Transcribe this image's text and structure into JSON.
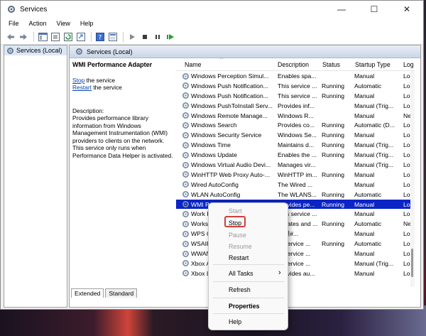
{
  "window": {
    "title": "Services",
    "controls": {
      "minimize": "—",
      "maximize": "☐",
      "close": "✕"
    }
  },
  "menu": [
    "File",
    "Action",
    "View",
    "Help"
  ],
  "toolbar_icons": [
    "back-icon",
    "forward-icon",
    "console-tree-icon",
    "properties-icon",
    "refresh-icon",
    "export-icon",
    "help-icon",
    "view-icon",
    "start-icon",
    "stop-icon",
    "pause-icon",
    "restart-icon"
  ],
  "tree": {
    "item": "Services (Local)"
  },
  "main": {
    "header": "Services (Local)"
  },
  "detail": {
    "title": "WMI Performance Adapter",
    "stop_link": "Stop",
    "stop_rest": " the service",
    "restart_link": "Restart",
    "restart_rest": " the service",
    "desc_label": "Description:",
    "desc_lines": [
      "Provides performance library",
      "information from Windows",
      "Management Instrumentation (WMI)",
      "providers to clients on the network.",
      "This service only runs when",
      "Performance Data Helper is activated."
    ]
  },
  "columns": [
    "Name",
    "Description",
    "Status",
    "Startup Type",
    "Log"
  ],
  "rows": [
    [
      "Windows Perception Simul...",
      "Enables spa...",
      "",
      "Manual",
      "Loc"
    ],
    [
      "Windows Push Notification...",
      "This service ...",
      "Running",
      "Automatic",
      "Loc"
    ],
    [
      "Windows Push Notification...",
      "This service ...",
      "Running",
      "Manual",
      "Loc"
    ],
    [
      "Windows PushToInstall Serv...",
      "Provides inf...",
      "",
      "Manual (Trig...",
      "Loc"
    ],
    [
      "Windows Remote Manage...",
      "Windows R...",
      "",
      "Manual",
      "Net"
    ],
    [
      "Windows Search",
      "Provides co...",
      "Running",
      "Automatic (D...",
      "Loc"
    ],
    [
      "Windows Security Service",
      "Windows Se...",
      "Running",
      "Manual",
      "Loc"
    ],
    [
      "Windows Time",
      "Maintains d...",
      "Running",
      "Manual (Trig...",
      "Loc"
    ],
    [
      "Windows Update",
      "Enables the ...",
      "Running",
      "Manual (Trig...",
      "Loc"
    ],
    [
      "Windows Virtual Audio Devi...",
      "Manages vir...",
      "",
      "Manual (Trig...",
      "Loc"
    ],
    [
      "WinHTTP Web Proxy Auto-...",
      "WinHTTP im...",
      "Running",
      "Manual",
      "Loc"
    ],
    [
      "Wired AutoConfig",
      "The Wired ...",
      "",
      "Manual",
      "Loc"
    ],
    [
      "WLAN AutoConfig",
      "The WLANS...",
      "Running",
      "Automatic",
      "Loc"
    ],
    [
      "WMI Performance Adapter",
      "Provides pe...",
      "Running",
      "Manual",
      "Loc"
    ],
    [
      "Work Folders",
      "This service ...",
      "",
      "Manual",
      "Loc"
    ],
    [
      "Workstation",
      "Creates and ...",
      "Running",
      "Automatic",
      "Net"
    ],
    [
      "WPS Office Cloud Service",
      "提供#...",
      "",
      "Manual",
      "Loc"
    ],
    [
      "WSAIFabricSvc",
      "... service ...",
      "Running",
      "Automatic",
      "Loc"
    ],
    [
      "WWAN AutoConfig",
      "... service ...",
      "",
      "Manual",
      "Loc"
    ],
    [
      "Xbox Accessory Manage...",
      "... service ...",
      "",
      "Manual (Trig...",
      "Loc"
    ],
    [
      "Xbox Live Auth Manager",
      "Provides au...",
      "",
      "Manual",
      "Loc"
    ]
  ],
  "tabs": [
    "Extended",
    "Standard"
  ],
  "context_menu": {
    "start": "Start",
    "stop": "Stop",
    "pause": "Pause",
    "resume": "Resume",
    "restart": "Restart",
    "all_tasks": "All Tasks",
    "refresh": "Refresh",
    "properties": "Properties",
    "help": "Help",
    "submenu_arrow": "›"
  },
  "colors": {
    "selection": "#0b24c6",
    "highlight_box": "#d04038",
    "link": "#0645ad"
  }
}
